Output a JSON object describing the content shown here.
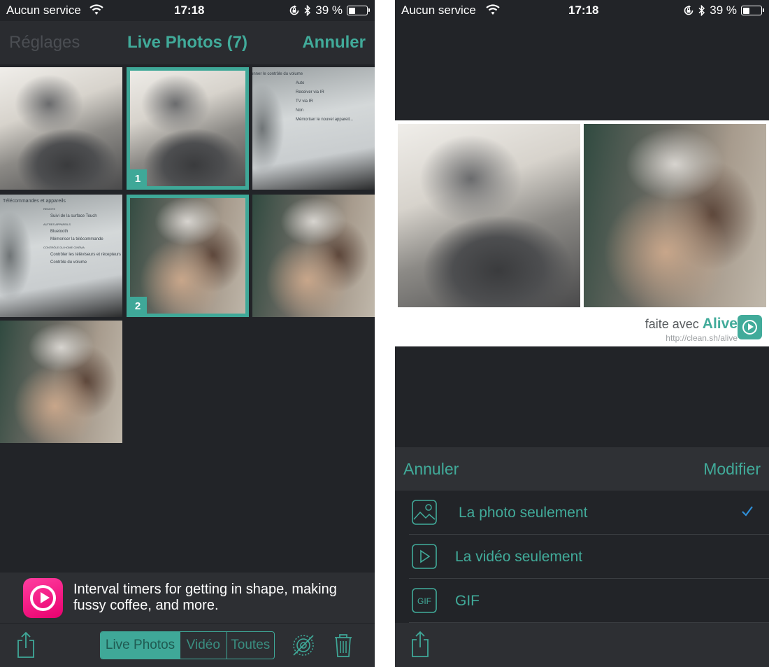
{
  "status_bar": {
    "carrier": "Aucun service",
    "time": "17:18",
    "battery": "39 %",
    "battery_level": 0.39
  },
  "left": {
    "nav": {
      "back_label": "Réglages",
      "title": "Live Photos (7)",
      "cancel_label": "Annuler"
    },
    "grid": {
      "selected_badges": [
        "1",
        "2"
      ],
      "tv_menu_1": [
        "Sélectionner le contrôle du volume",
        "Auto",
        "Receiver via IR",
        "TV via IR",
        "Non",
        "Mémoriser le nouvel appareil..."
      ],
      "tv_menu_2": [
        "Télécommandes et appareils",
        "REMOTE",
        "Suivi de la surface Touch",
        "AUTRES APPAREILS",
        "Bluetooth",
        "Mémoriser la télécommande",
        "CONTRÔLE DU HOME CINÉMA",
        "Contrôler les téléviseurs et récepteurs",
        "Contrôle du volume"
      ]
    },
    "ad": {
      "text": "Interval timers for getting in shape, making fussy coffee, and more.",
      "icon": "play-circle-icon",
      "color": "#ff1f8e"
    },
    "toolbar": {
      "segments": [
        "Live Photos",
        "Vidéo",
        "Toutes"
      ],
      "active_segment": "Live Photos",
      "icons": [
        "share-icon",
        "live-off-icon",
        "trash-icon"
      ]
    }
  },
  "right": {
    "preview": {
      "credit_prefix": "faite avec",
      "brand": "Alive",
      "url": "http://clean.sh/alive"
    },
    "sheet": {
      "cancel_label": "Annuler",
      "edit_label": "Modifier",
      "options": [
        {
          "label": "La photo seulement",
          "icon": "photo-icon",
          "checked": true
        },
        {
          "label": "La vidéo seulement",
          "icon": "play-icon",
          "checked": false
        },
        {
          "label": "GIF",
          "icon": "gif-icon",
          "checked": false
        }
      ]
    },
    "toolbar": {
      "icons": [
        "share-icon"
      ]
    }
  },
  "colors": {
    "accent": "#41ab9a",
    "background": "#222428",
    "bar": "#2d2f33",
    "check": "#2f8fd8"
  }
}
